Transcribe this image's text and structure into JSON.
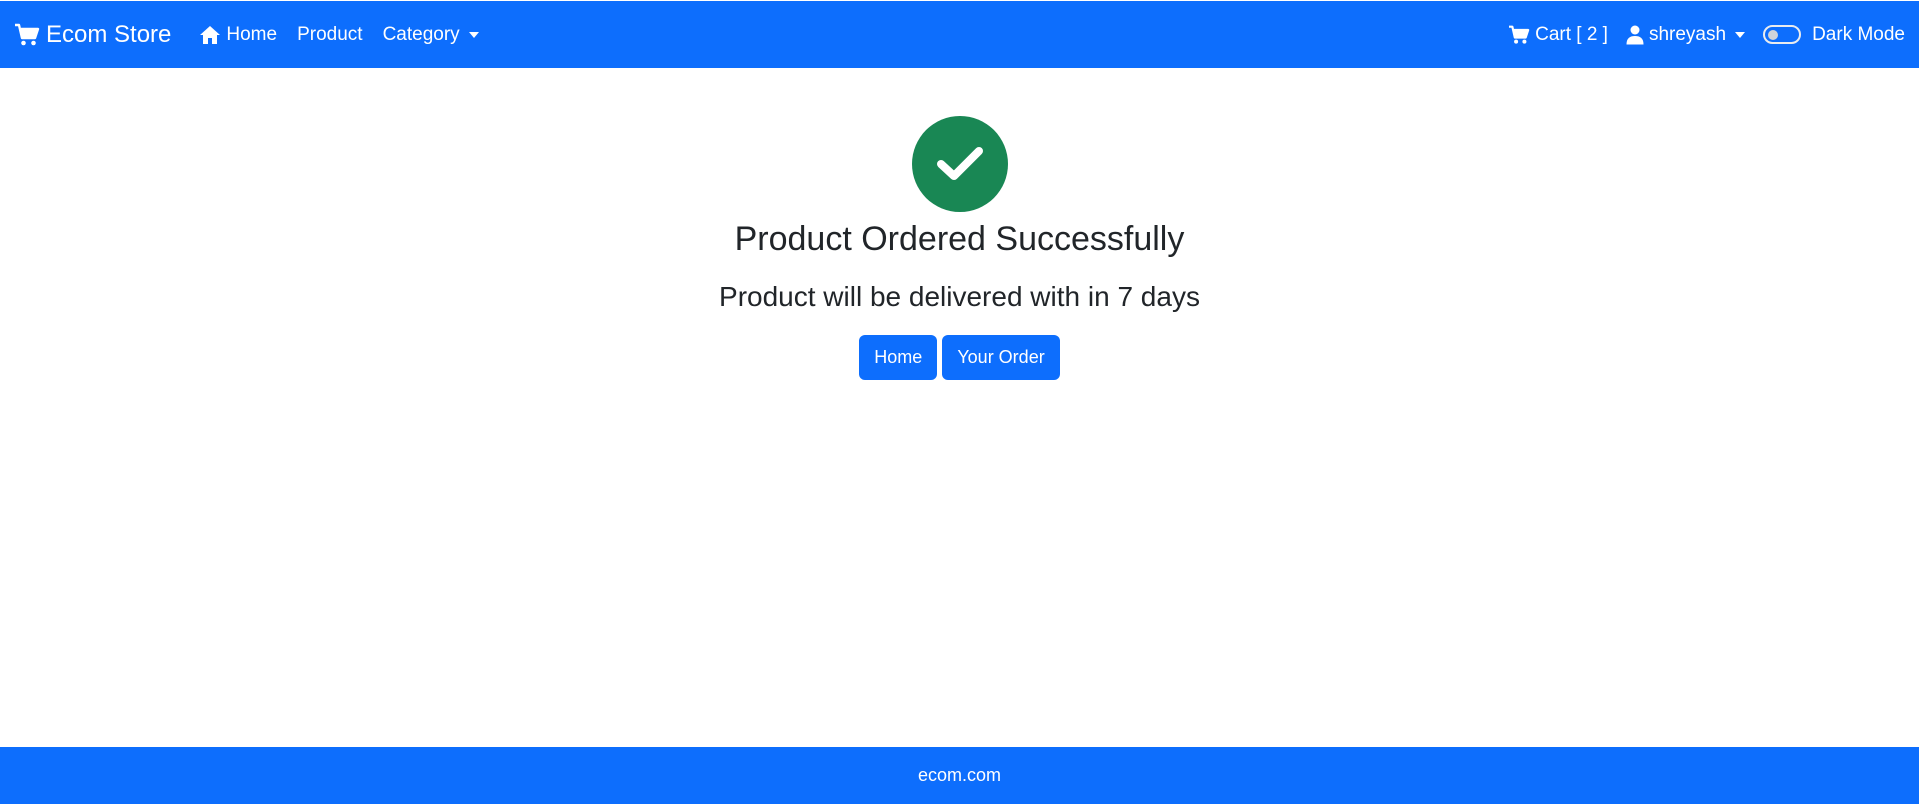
{
  "navbar": {
    "brand": "Ecom Store",
    "links": {
      "home": "Home",
      "product": "Product",
      "category": "Category"
    },
    "cart_label": "Cart [ 2 ]",
    "user_name": "shreyash",
    "dark_mode_label": "Dark Mode",
    "dark_mode_on": false
  },
  "confirmation": {
    "icon": "check-icon",
    "title": "Product Ordered Successfully",
    "subtitle": "Product will be delivered with in 7 days",
    "buttons": {
      "home": "Home",
      "orders": "Your Order"
    }
  },
  "footer": {
    "text": "ecom.com"
  },
  "colors": {
    "primary": "#0d6efd",
    "success": "#198754",
    "text": "#212529"
  }
}
